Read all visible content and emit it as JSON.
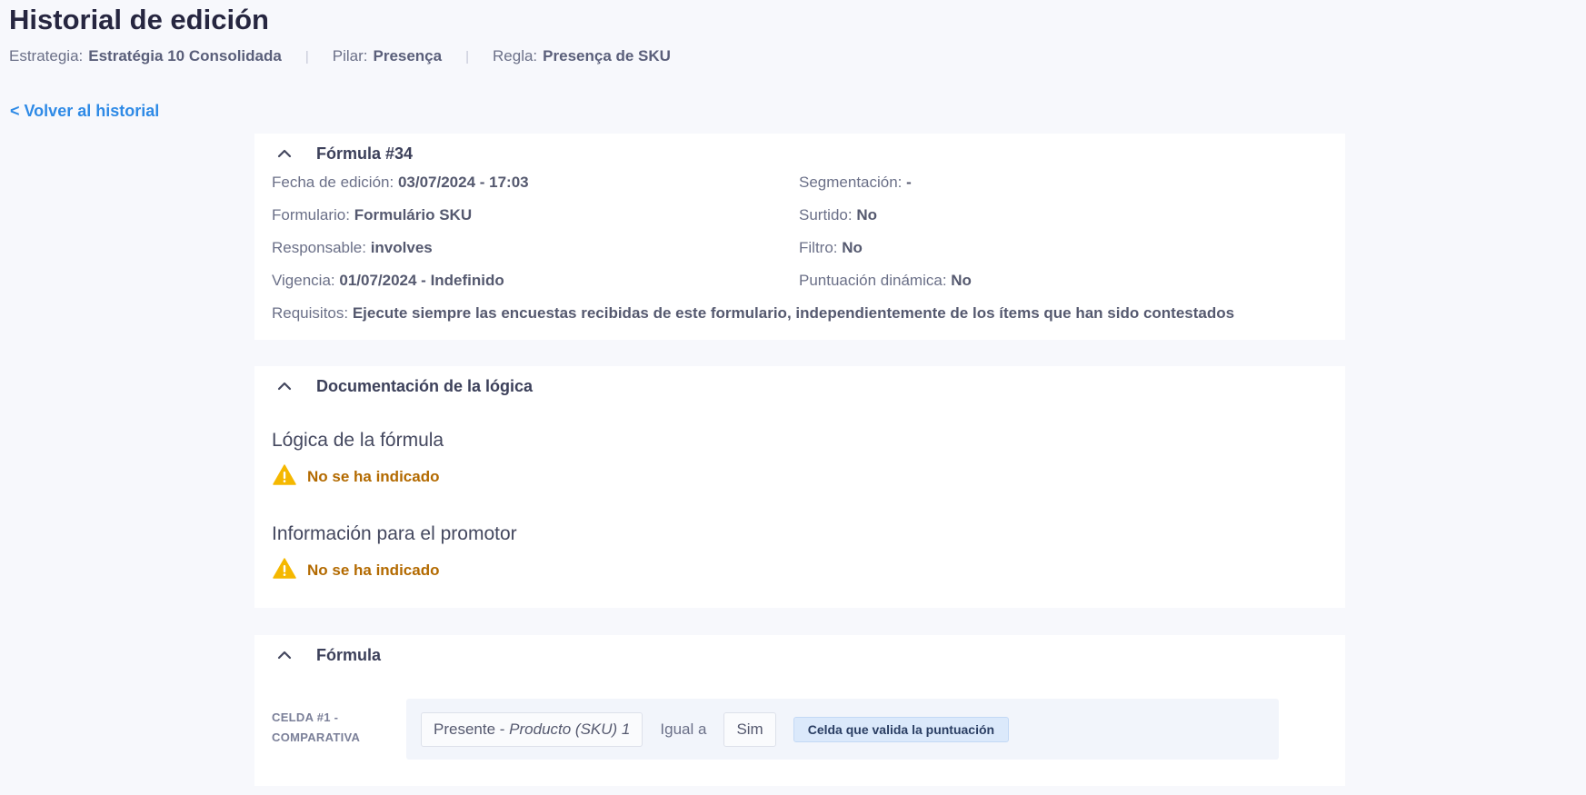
{
  "page": {
    "title": "Historial de edición",
    "meta": [
      {
        "label": "Estrategia:",
        "value": "Estratégia 10 Consolidada"
      },
      {
        "label": "Pilar:",
        "value": "Presença"
      },
      {
        "label": "Regla:",
        "value": "Presença de SKU"
      }
    ],
    "back_link": "< Volver al historial"
  },
  "formula_card": {
    "title": "Fórmula #34",
    "fields": {
      "fecha_label": "Fecha de edición:",
      "fecha_value": "03/07/2024 - 17:03",
      "formulario_label": "Formulario:",
      "formulario_value": "Formulário SKU",
      "responsable_label": "Responsable:",
      "responsable_value": "involves",
      "vigencia_label": "Vigencia:",
      "vigencia_value": "01/07/2024 - Indefinido",
      "segmentacion_label": "Segmentación:",
      "segmentacion_value": "-",
      "surtido_label": "Surtido:",
      "surtido_value": "No",
      "filtro_label": "Filtro:",
      "filtro_value": "No",
      "puntuacion_label": "Puntuación dinámica:",
      "puntuacion_value": "No",
      "requisitos_label": "Requisitos:",
      "requisitos_value": "Ejecute siempre las encuestas recibidas de este formulario, independientemente de los ítems que han sido contestados"
    }
  },
  "doc_card": {
    "title": "Documentación de la lógica",
    "logic_heading": "Lógica de la fórmula",
    "logic_warning": "No se ha indicado",
    "promoter_heading": "Información para el promotor",
    "promoter_warning": "No se ha indicado"
  },
  "formula_section": {
    "title": "Fórmula",
    "cell_label_line1": "CELDA #1 -",
    "cell_label_line2": "COMPARATIVA",
    "left_operand_prefix": "Presente - ",
    "left_operand_italic": "Producto (SKU) 1",
    "operator": "Igual a",
    "right_operand": "Sim",
    "badge": "Celda que valida la puntuación"
  },
  "colors": {
    "accent_link": "#2e8ae6",
    "warning_icon": "#f5b800",
    "warning_text": "#b36a00",
    "badge_bg": "#dbe9fb"
  },
  "icons": [
    "chevron-up-icon",
    "warning-icon"
  ]
}
